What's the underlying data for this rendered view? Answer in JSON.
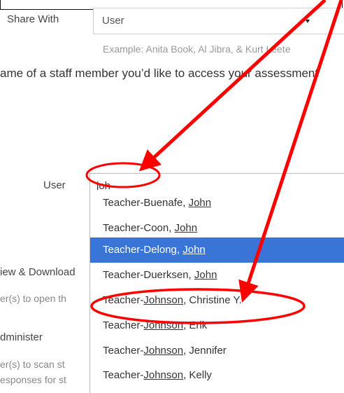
{
  "share": {
    "label": "Share With",
    "value": "User",
    "example": "Example: Anita Book, Al Jibra, & Kurt Leete"
  },
  "instruction": "ame of a staff member you’d like to access your assessment",
  "user_field": {
    "label": "User",
    "typed": "joh"
  },
  "dropdown": {
    "items": [
      {
        "prefix": "Teacher-Buenafe, ",
        "match": "John",
        "suffix": ""
      },
      {
        "prefix": "Teacher-Coon, ",
        "match": "John",
        "suffix": ""
      },
      {
        "prefix": "Teacher-Delong, ",
        "match": "John",
        "suffix": ""
      },
      {
        "prefix": "Teacher-Duerksen, ",
        "match": "John",
        "suffix": ""
      },
      {
        "prefix": "Teacher-",
        "match": "Johnson",
        "suffix": ", Christine Y."
      },
      {
        "prefix": "Teacher-",
        "match": "Johnson",
        "suffix": ", Erik"
      },
      {
        "prefix": "Teacher-",
        "match": "Johnson",
        "suffix": ", Jennifer"
      },
      {
        "prefix": "Teacher-",
        "match": "Johnson",
        "suffix": ", Kelly"
      }
    ],
    "selected_index": 2
  },
  "permissions": {
    "view_label": "iew & Download",
    "view_desc": "er(s) to open th",
    "admin_label": "dminister",
    "admin_desc_1": "er(s) to scan st",
    "admin_desc_2": "esponses for st"
  },
  "annotation_color": "#ff0000",
  "selection_color": "#3875d7"
}
